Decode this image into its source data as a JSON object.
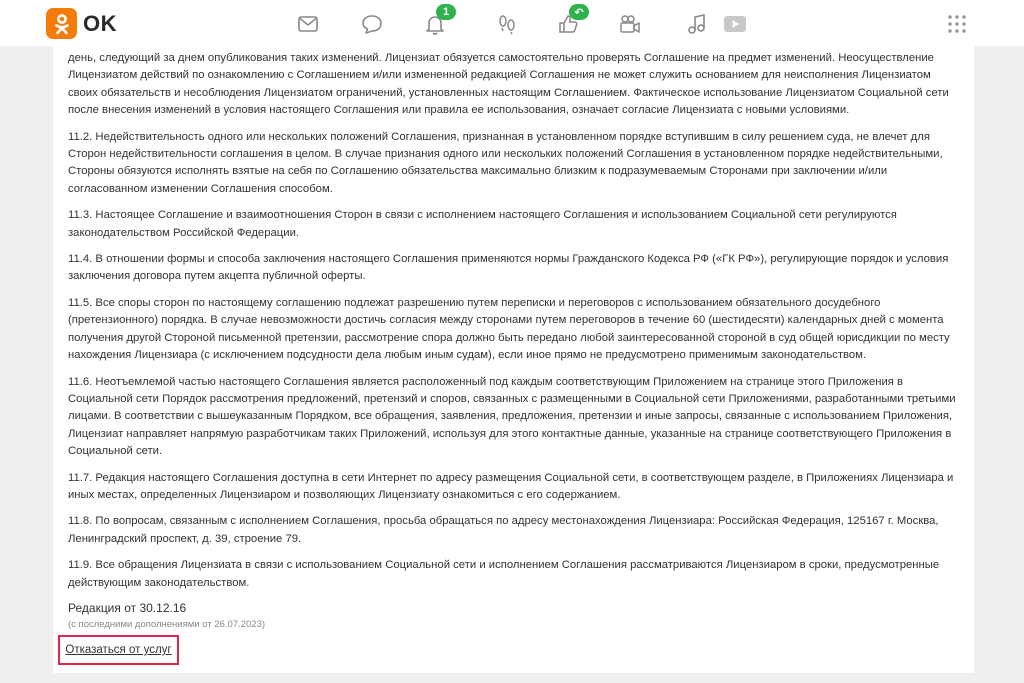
{
  "header": {
    "logo_text": "OK",
    "nav_icons": [
      {
        "name": "messages-icon"
      },
      {
        "name": "discussions-icon"
      },
      {
        "name": "notifications-icon",
        "badge": "1"
      },
      {
        "name": "guests-icon"
      },
      {
        "name": "events-icon",
        "badge": "↶"
      },
      {
        "name": "video-icon"
      },
      {
        "name": "music-icon"
      },
      {
        "name": "play-icon"
      }
    ],
    "colors": {
      "brand": "#f47c0b",
      "badge": "#2fb24c",
      "highlight": "#e0264f"
    }
  },
  "agreement": {
    "paragraphs": [
      "день, следующий за днем опубликования таких изменений. Лицензиат обязуется самостоятельно проверять Соглашение на предмет изменений. Неосуществление Лицензиатом действий по ознакомлению с Соглашением и/или измененной редакцией Соглашения не может служить основанием для неисполнения Лицензиатом своих обязательств и несоблюдения Лицензиатом ограничений, установленных настоящим Соглашением. Фактическое использование Лицензиатом Социальной сети после внесения изменений в условия настоящего Соглашения или правила ее использования, означает согласие Лицензиата с новыми условиями.",
      "11.2. Недействительность одного или нескольких положений Соглашения, признанная в установленном порядке вступившим в силу решением суда, не влечет для Сторон недействительности соглашения в целом. В случае признания одного или нескольких положений Соглашения в установленном порядке недействительными, Стороны обязуются исполнять взятые на себя по Соглашению обязательства максимально близким к подразумеваемым Сторонами при заключении и/или согласованном изменении Соглашения способом.",
      "11.3. Настоящее Соглашение и взаимоотношения Сторон в связи с исполнением настоящего Соглашения и использованием Социальной сети регулируются законодательством Российской Федерации.",
      "11.4. В отношении формы и способа заключения настоящего Соглашения применяются нормы Гражданского Кодекса РФ («ГК РФ»), регулирующие порядок и условия заключения договора путем акцепта публичной оферты.",
      "11.5. Все споры сторон по настоящему соглашению подлежат разрешению путем переписки и переговоров с использованием обязательного досудебного (претензионного) порядка. В случае невозможности достичь согласия между сторонами путем переговоров в течение 60 (шестидесяти) календарных дней с момента получения другой Стороной письменной претензии, рассмотрение спора должно быть передано любой заинтересованной стороной в суд общей юрисдикции по месту нахождения Лицензиара (с исключением подсудности дела любым иным судам), если иное прямо не предусмотрено применимым законодательством.",
      "11.6. Неотъемлемой частью настоящего Соглашения является расположенный под каждым соответствующим Приложением на странице этого Приложения в Социальной сети Порядок рассмотрения предложений, претензий и споров, связанных с размещенными в Социальной сети Приложениями, разработанными третьими лицами. В соответствии с вышеуказанным Порядком, все обращения, заявления, предложения, претензии и иные запросы, связанные с использованием Приложения, Лицензиат направляет напрямую разработчикам таких Приложений, используя для этого контактные данные, указанные на странице соответствующего Приложения в Социальной сети.",
      "11.7. Редакция настоящего Соглашения доступна в сети Интернет по адресу размещения Социальной сети, в соответствующем разделе, в Приложениях Лицензиара и иных местах, определенных Лицензиаром и позволяющих Лицензиату ознакомиться с его содержанием.",
      "11.8. По вопросам, связанным с исполнением Соглашения, просьба обращаться по адресу местонахождения Лицензиара: Российская Федерация, 125167 г. Москва, Ленинградский проспект, д. 39, строение 79.",
      "11.9. Все обращения Лицензиата в связи с использованием Социальной сети и исполнением Соглашения рассматриваются Лицензиаром в сроки, предусмотренные действующим законодательством."
    ],
    "edition": "Редакция от 30.12.16",
    "edition_note": "(с последними дополнениями от 26.07.2023)",
    "unsubscribe_link": "Отказаться от услуг"
  }
}
